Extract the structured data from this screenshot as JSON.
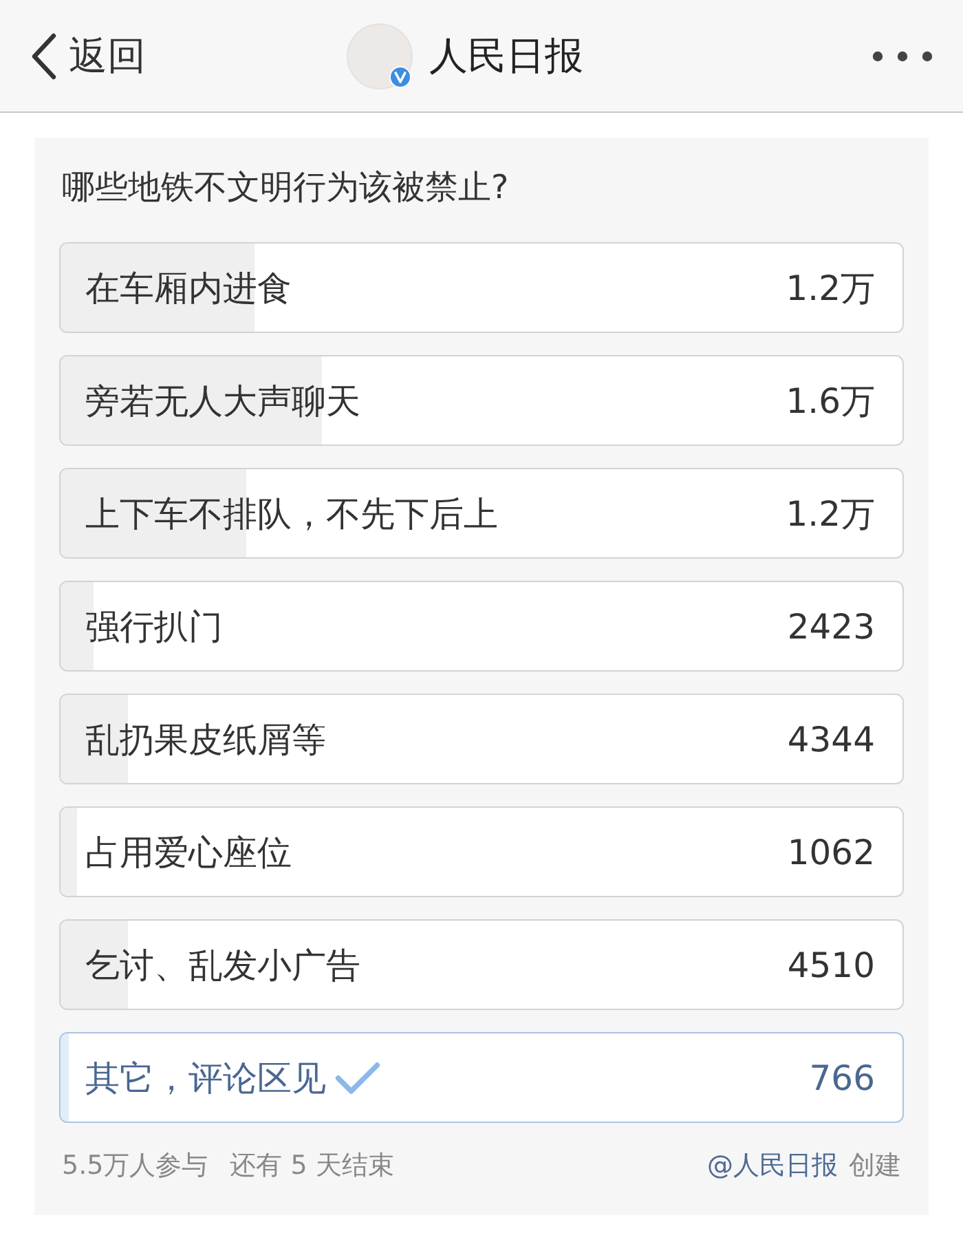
{
  "nav": {
    "back": "返回",
    "title": "人民日报"
  },
  "poll": {
    "question": "哪些地铁不文明行为该被禁止?",
    "options": [
      {
        "label": "在车厢内进食",
        "count": "1.2万",
        "level": 0.23,
        "selected": false
      },
      {
        "label": "旁若无人大声聊天",
        "count": "1.6万",
        "level": 0.31,
        "selected": false
      },
      {
        "label": "上下车不排队，不先下后上",
        "count": "1.2万",
        "level": 0.22,
        "selected": false
      },
      {
        "label": "强行扒门",
        "count": "2423",
        "level": 0.04,
        "selected": false
      },
      {
        "label": "乱扔果皮纸屑等",
        "count": "4344",
        "level": 0.08,
        "selected": false
      },
      {
        "label": "占用爱心座位",
        "count": "1062",
        "level": 0.02,
        "selected": false
      },
      {
        "label": "乞讨、乱发小广告",
        "count": "4510",
        "level": 0.08,
        "selected": false
      },
      {
        "label": "其它，评论区见",
        "count": "766",
        "level": 0.01,
        "selected": true
      }
    ],
    "footer": {
      "participants": "5.5万人参与",
      "remaining": "还有 5 天结束",
      "creator": "@人民日报",
      "created": "创建"
    }
  }
}
